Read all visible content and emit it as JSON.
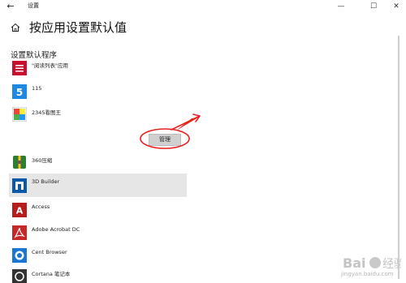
{
  "window": {
    "title": "设置",
    "back_glyph": "←",
    "minimize_glyph": "—",
    "maximize_glyph": "☐",
    "close_glyph": "✕"
  },
  "header": {
    "title": "按应用设置默认值"
  },
  "section": {
    "title": "设置默认程序"
  },
  "apps": [
    {
      "label": "\"阅读列表\"应用",
      "icon": "reading-list-icon",
      "color": "#c8102e"
    },
    {
      "label": "115",
      "icon": "115-icon",
      "color": "#1e88e5"
    },
    {
      "label": "2345看图王",
      "icon": "2345-image-viewer-icon",
      "color": "#4caf50"
    },
    {
      "label": "360压缩",
      "icon": "360-zip-icon",
      "color": "#2e7d32"
    },
    {
      "label": "3D Builder",
      "icon": "3d-builder-icon",
      "color": "#0a58a7"
    },
    {
      "label": "Access",
      "icon": "access-icon",
      "color": "#b71c1c"
    },
    {
      "label": "Adobe Acrobat DC",
      "icon": "adobe-acrobat-icon",
      "color": "#c62828"
    },
    {
      "label": "Cent Browser",
      "icon": "cent-browser-icon",
      "color": "#1976d2"
    },
    {
      "label": "Cortana 笔记本",
      "icon": "cortana-notebook-icon",
      "color": "#333333"
    }
  ],
  "manage_button": {
    "label": "管理"
  },
  "watermark": {
    "text": "jingyan.baidu.com"
  },
  "colors": {
    "selected_row": "#e6e6e6",
    "annotation": "#e8231f"
  }
}
